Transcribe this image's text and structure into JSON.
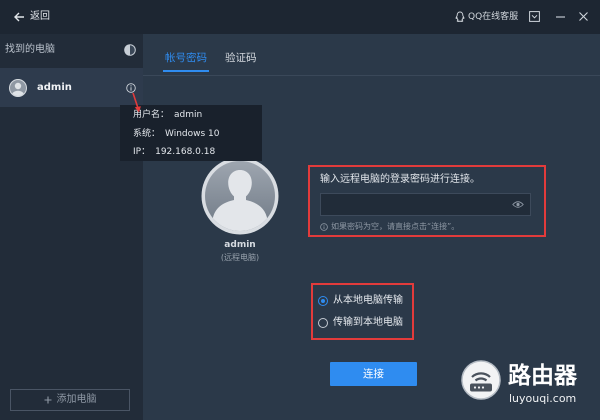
{
  "window": {
    "back_label": "返回",
    "support_label": "QQ在线客服"
  },
  "sidebar": {
    "header": "找到的电脑",
    "computers": [
      {
        "name": "admin",
        "selected": true
      }
    ],
    "add_button_label": "添加电脑"
  },
  "computer_info_tooltip": {
    "rows": [
      {
        "label": "用户名：",
        "value": "admin"
      },
      {
        "label": "系统：",
        "value": "Windows 10"
      },
      {
        "label": "IP：",
        "value": "192.168.0.18"
      }
    ]
  },
  "tabs": [
    {
      "label": "帐号密码",
      "active": true
    },
    {
      "label": "验证码",
      "active": false
    }
  ],
  "remote_computer": {
    "name": "admin",
    "caption": "(远程电脑)"
  },
  "password": {
    "prompt": "输入远程电脑的登录密码进行连接。",
    "value": "",
    "hint": "如果密码为空，请直接点击“连接”。"
  },
  "transfer": {
    "options": [
      {
        "label": "从本地电脑传输",
        "selected": true
      },
      {
        "label": "传输到本地电脑",
        "selected": false
      }
    ]
  },
  "connect_button_label": "连接",
  "watermark": {
    "name": "路由器",
    "domain": "luyouqi.com"
  },
  "colors": {
    "accent": "#2f8cf0",
    "annotation": "#e23b3b"
  },
  "icons": {
    "back": "arrow-left-icon",
    "support": "qq-icon",
    "menu": "dropdown-box-icon",
    "minimize": "minimize-icon",
    "close": "close-icon",
    "refresh": "refresh-spinner-icon",
    "avatar": "user-avatar-icon",
    "info": "info-icon",
    "password_visibility": "eye-icon",
    "add": "plus-icon",
    "watermark": "router-logo-icon"
  }
}
